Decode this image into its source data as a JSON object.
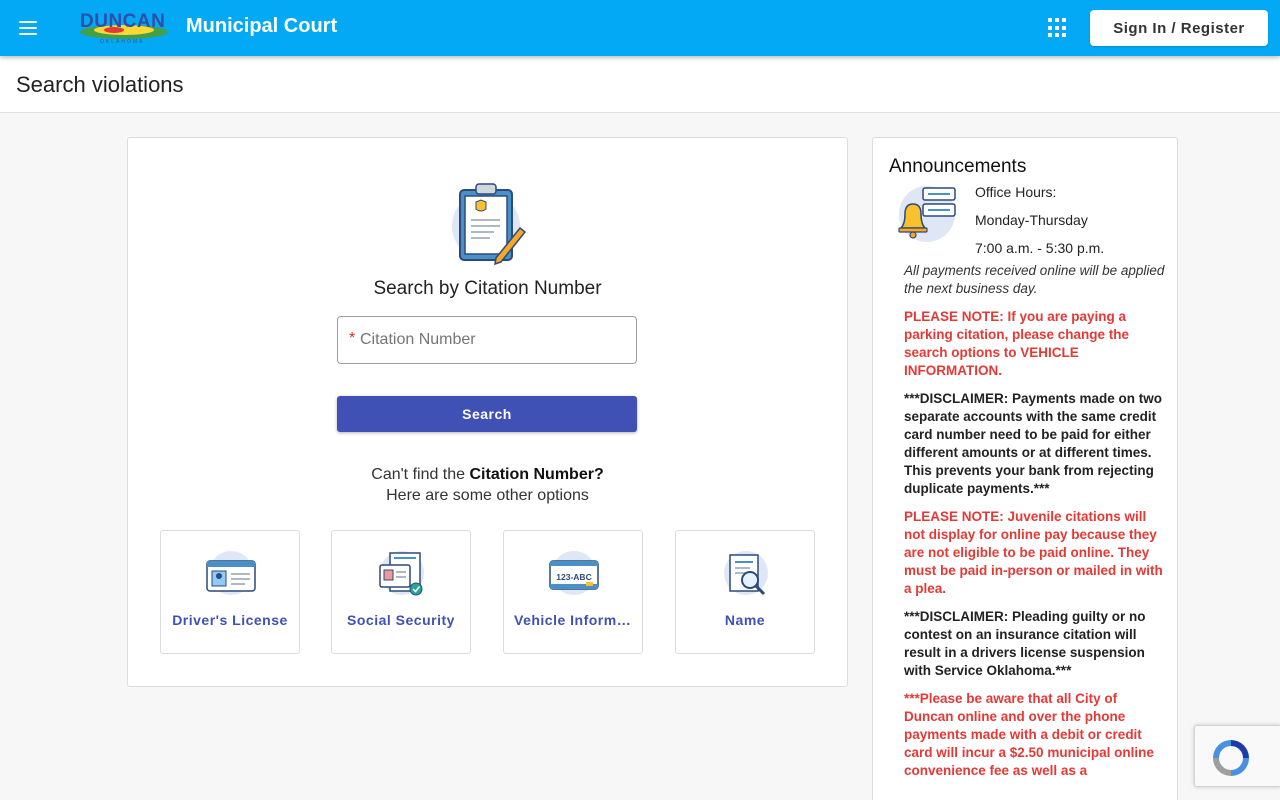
{
  "header": {
    "logo_text": "DUNCAN",
    "logo_sub": "OKLAHOMA",
    "title": "Municipal Court",
    "signin_label": "Sign In / Register"
  },
  "page": {
    "title": "Search violations"
  },
  "search": {
    "heading": "Search by Citation Number",
    "required_mark": "*",
    "placeholder": "Citation Number",
    "value": "",
    "button_label": "Search",
    "cant_find_prefix": "Can't find the",
    "cant_find_bold": "Citation Number?",
    "other_options": "Here are some other options"
  },
  "options": [
    {
      "label": "Driver's License",
      "icon": "drivers-license-icon"
    },
    {
      "label": "Social Security",
      "icon": "social-security-icon"
    },
    {
      "label": "Vehicle Information",
      "icon": "vehicle-plate-icon"
    },
    {
      "label": "Name",
      "icon": "name-search-icon"
    }
  ],
  "plate_text": "123-ABC",
  "announcements": {
    "title": "Announcements",
    "hours_label": "Office Hours:",
    "hours_days": "Monday-Thursday",
    "hours_time": "7:00 a.m. - 5:30 p.m.",
    "note_online": "All payments received online will be applied the next business day.",
    "note_parking": "PLEASE NOTE: If you are paying a parking citation, please change the search options to VEHICLE INFORMATION.",
    "disclaimer_cards": "***DISCLAIMER:  Payments made on two separate accounts with the same credit card number need to be paid for either different amounts or at different times.  This prevents your bank from rejecting duplicate payments.***",
    "note_juvenile": "PLEASE NOTE: Juvenile citations will not display for online pay because they are not eligible to be paid online. They must be paid in-person or mailed in with a plea.",
    "disclaimer_insurance": "***DISCLAIMER: Pleading guilty or no contest on an insurance citation will result in a drivers license suspension with Service Oklahoma.***",
    "note_fee": "***Please be aware that all City of Duncan online and over the phone payments made with a debit or credit card will incur a $2.50 municipal online convenience fee as well as a"
  },
  "colors": {
    "topbar": "#03a9f4",
    "primary": "#3f51b5",
    "alert_red": "#e53935"
  }
}
